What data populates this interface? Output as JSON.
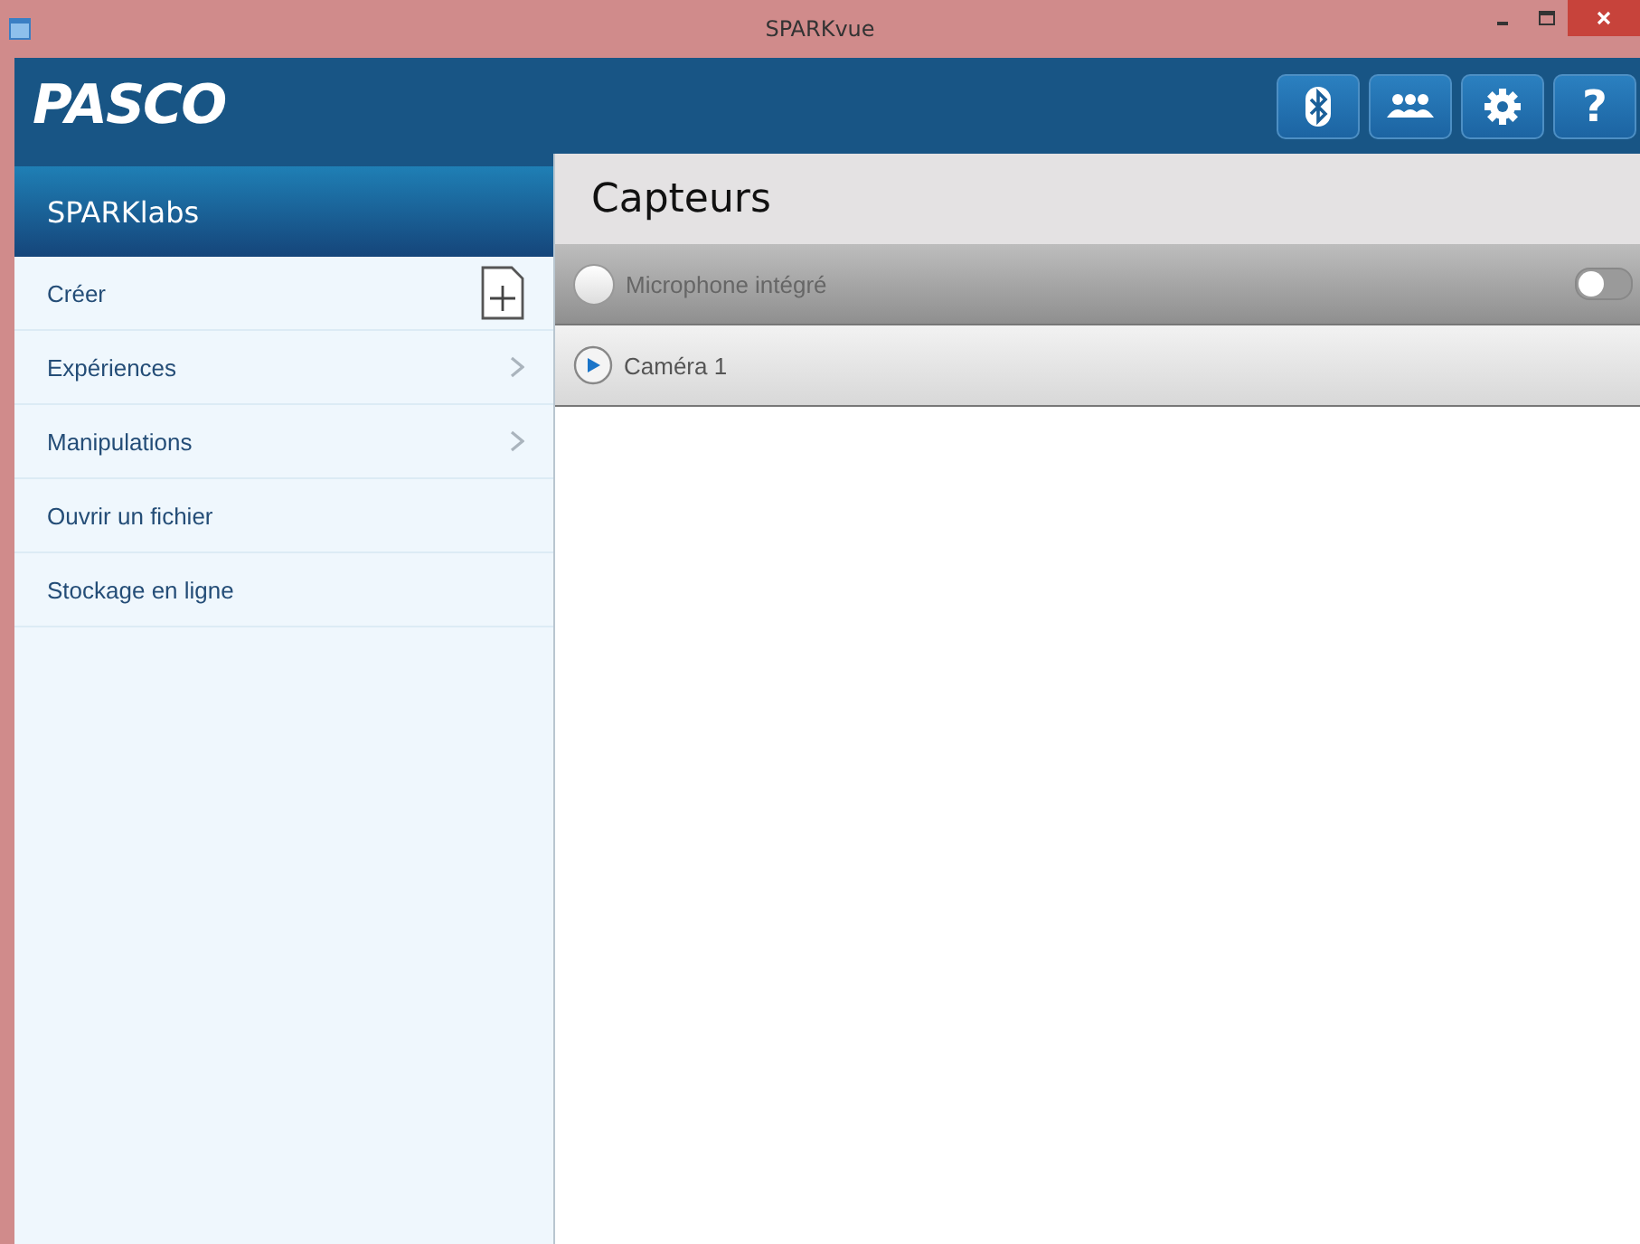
{
  "window": {
    "title": "SPARKvue"
  },
  "header": {
    "logo": "PASCO",
    "buttons": [
      {
        "kind": "bluetooth"
      },
      {
        "kind": "people"
      },
      {
        "kind": "settings"
      },
      {
        "kind": "help",
        "label": "?"
      }
    ]
  },
  "sidebar": {
    "title": "SPARKlabs",
    "items": [
      {
        "label": "Créer",
        "kind": "new"
      },
      {
        "label": "Expériences",
        "kind": "submenu"
      },
      {
        "label": "Manipulations",
        "kind": "submenu"
      },
      {
        "label": "Ouvrir un fichier",
        "kind": "plain"
      },
      {
        "label": "Stockage en ligne",
        "kind": "plain"
      }
    ]
  },
  "sensors": {
    "title": "Capteurs",
    "rows": [
      {
        "name": "Microphone intégré",
        "kind": "toggle",
        "on": false
      },
      {
        "name": "Caméra 1",
        "kind": "play"
      }
    ]
  }
}
